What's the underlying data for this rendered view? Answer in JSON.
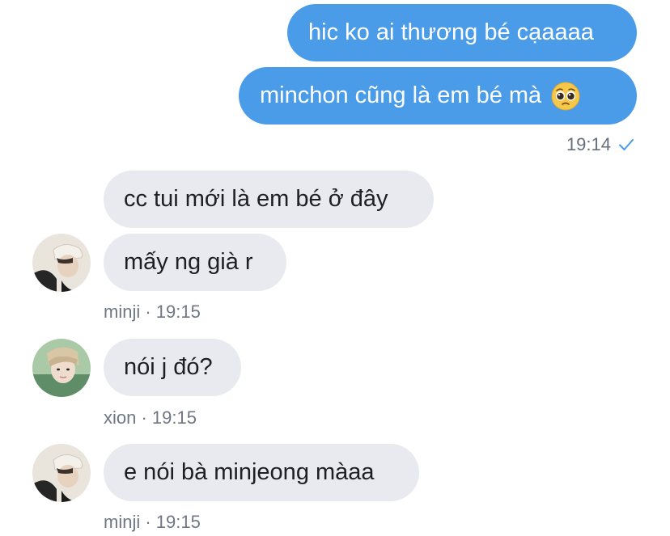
{
  "messages": {
    "out_1": "hic ko ai thương bé cạaaaa",
    "out_2": "minchon cũng là em bé mà",
    "out_status_time": "19:14",
    "in_1": "cc tui mới là em bé ở đây",
    "in_2": "mấy ng già r",
    "in_2_meta": "minji · 19:15",
    "in_3": "nói j đó?",
    "in_3_meta": "xion · 19:15",
    "in_4": "e nói bà minjeong màaa",
    "in_4_meta": "minji · 19:15"
  },
  "icons": {
    "emoji": "pleading-face-emoji",
    "read_status": "checkmark-icon",
    "avatar_1": "minji-avatar",
    "avatar_2": "xion-avatar",
    "avatar_3": "minji-avatar"
  },
  "colors": {
    "outgoing_bubble": "#4a9ce8",
    "incoming_bubble": "#e8eaef",
    "meta_text": "#6f7784"
  }
}
